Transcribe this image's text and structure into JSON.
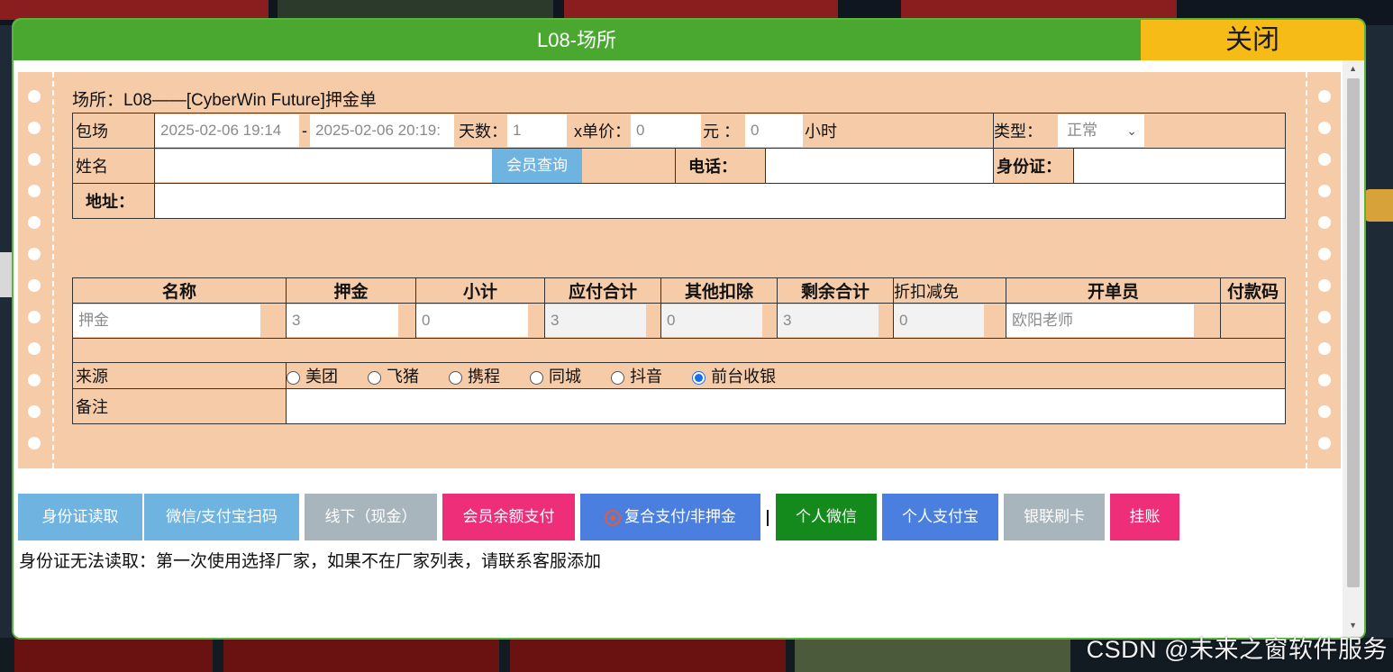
{
  "modal": {
    "title": "L08-场所",
    "close_label": "关闭"
  },
  "ticket": {
    "title": "场所：L08——[CyberWin Future]押金单",
    "row_booking": {
      "label": "包场",
      "start_time": "2025-02-06 19:14",
      "dash": "-",
      "end_time": "2025-02-06 20:19:",
      "days_label": "天数：",
      "days_value": "1",
      "unit_price_label": "x单价：",
      "unit_price_value": "0",
      "yuan_label": "元 ：",
      "hours_value": "0",
      "hours_label": "小时",
      "type_label": "类型：",
      "type_value": "正常"
    },
    "row_name": {
      "name_label": "姓名",
      "member_query_label": "会员查询",
      "phone_label": "电话：",
      "id_label": "身份证："
    },
    "row_address": {
      "address_label": "地址："
    },
    "items_table": {
      "headers": [
        "名称",
        "押金",
        "小计",
        "应付合计",
        "其他扣除",
        "剩余合计",
        "折扣减免",
        "开单员",
        "付款码"
      ],
      "row": {
        "name_placeholder": "押金",
        "deposit": "3",
        "subtotal": "0",
        "payable_total": "3",
        "other_deduction": "0",
        "remaining_total": "3",
        "discount": "0",
        "operator": "欧阳老师"
      }
    },
    "source": {
      "label": "来源",
      "options": [
        "美团",
        "飞猪",
        "携程",
        "同城",
        "抖音",
        "前台收银"
      ],
      "selected": "前台收银"
    },
    "remark": {
      "label": "备注"
    }
  },
  "buttons": {
    "id_read": "身份证读取",
    "wechat_alipay_scan": "微信/支付宝扫码",
    "offline_cash": "线下（现金）",
    "member_balance": "会员余额支付",
    "combo_pay": "复合支付/非押金",
    "personal_wechat": "个人微信",
    "personal_alipay": "个人支付宝",
    "unionpay_card": "银联刷卡",
    "on_account": "挂账"
  },
  "notice": "身份证无法读取：第一次使用选择厂家，如果不在厂家列表，请联系客服添加",
  "watermark": "CSDN @未来之窗软件服务",
  "colors": {
    "header_green": "#4aa831",
    "close_yellow": "#f6bb17",
    "ticket_peach": "#f5cba8",
    "btn_blue_light": "#6fb3e0",
    "btn_gray": "#a9b5bd",
    "btn_pink": "#ef2e7a",
    "btn_blue": "#4a7fe0",
    "btn_green": "#138a1b"
  }
}
